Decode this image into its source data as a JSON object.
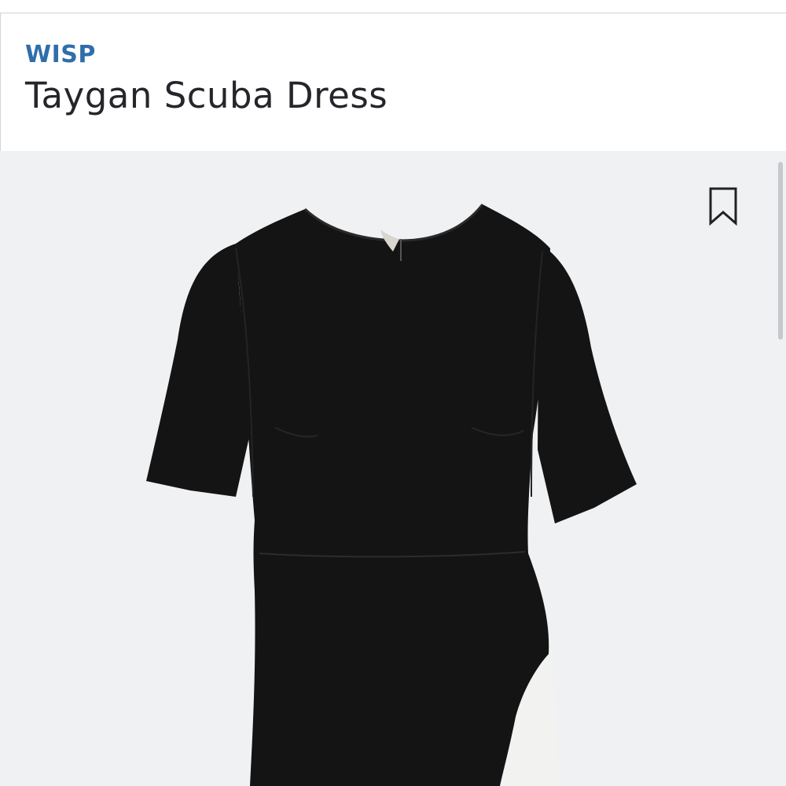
{
  "product": {
    "brand": "WISP",
    "title": "Taygan Scuba Dress"
  },
  "image": {
    "subject": "dress-photo",
    "background_color": "#f0f1f3",
    "garment_color": "#141414",
    "accent_color": "#f2f2f0"
  },
  "icons": {
    "bookmark": "bookmark-icon"
  },
  "colors": {
    "brand": "#2f6eaa",
    "title": "#25252b"
  }
}
